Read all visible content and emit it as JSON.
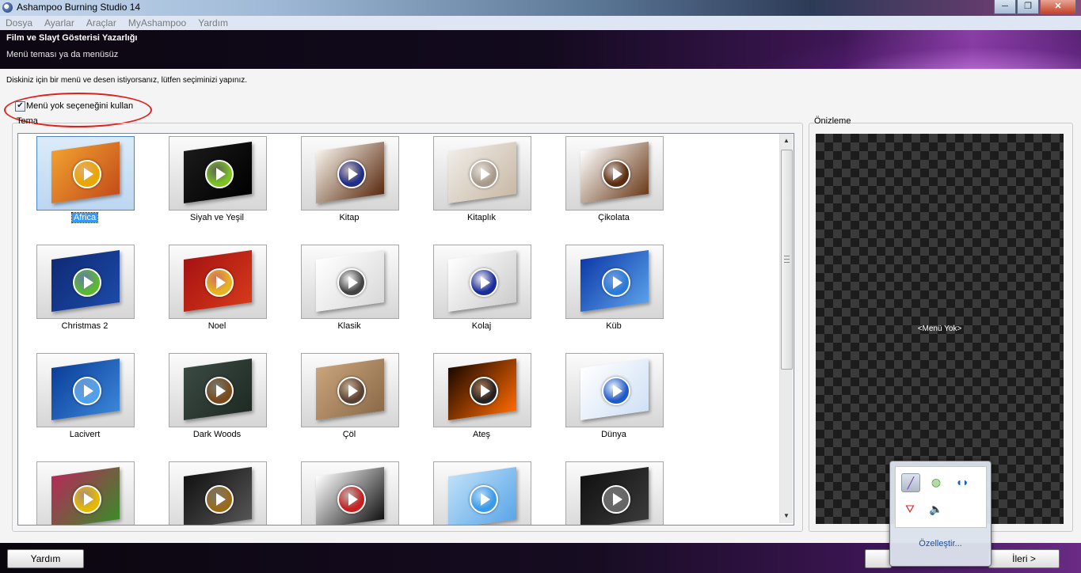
{
  "window": {
    "title": "Ashampoo Burning Studio 14",
    "buttons": [
      "─",
      "❐",
      "✕"
    ]
  },
  "menubar": [
    "Dosya",
    "Ayarlar",
    "Araçlar",
    "MyAshampoo",
    "Yardım"
  ],
  "header": {
    "title": "Film ve Slayt Gösterisi Yazarlığı",
    "subtitle": "Menü teması ya da menüsüz"
  },
  "instruction": "Diskiniz için bir menü ve desen istiyorsanız, lütfen seçiminizi yapınız.",
  "no_menu_option": {
    "label": "Menü yok seçeneğini kullan",
    "checked": true
  },
  "theme_group_label": "Tema",
  "preview_group_label": "Önizleme",
  "preview_text": "<Menü Yok>",
  "themes": [
    {
      "name": "Africa",
      "selected": true,
      "c1": "#f0a030",
      "c2": "#c44d1a",
      "btn": "#e8a800"
    },
    {
      "name": "Siyah ve Yeşil",
      "c1": "#1a1a1a",
      "c2": "#000000",
      "btn": "#7cc222"
    },
    {
      "name": "Kitap",
      "c1": "#f7f3ea",
      "c2": "#5a2a10",
      "btn": "#1f2e8a"
    },
    {
      "name": "Kitaplık",
      "c1": "#efece7",
      "c2": "#c9b9a5",
      "btn": "#a79a8c"
    },
    {
      "name": "Çikolata",
      "c1": "#ffffff",
      "c2": "#6b3b1a",
      "btn": "#5a2d12"
    },
    {
      "name": "Christmas 2",
      "c1": "#0f2a75",
      "c2": "#1c4aa8",
      "btn": "#5cb82e"
    },
    {
      "name": "Noel",
      "c1": "#a51212",
      "c2": "#d63a1a",
      "btn": "#e6b420"
    },
    {
      "name": "Klasik",
      "c1": "#ffffff",
      "c2": "#d9d9d9",
      "btn": "#444444"
    },
    {
      "name": "Kolaj",
      "c1": "#ffffff",
      "c2": "#cccccc",
      "btn": "#1a2a9a"
    },
    {
      "name": "Küb",
      "c1": "#0d3aa8",
      "c2": "#5aa0ea",
      "btn": "#2a7ad8"
    },
    {
      "name": "Lacivert",
      "c1": "#0a3e99",
      "c2": "#3b86d8",
      "btn": "#4fa0ec"
    },
    {
      "name": "Dark Woods",
      "c1": "#3a4a42",
      "c2": "#1e2a24",
      "btn": "#7a4a1a"
    },
    {
      "name": "Çöl",
      "c1": "#c9a47c",
      "c2": "#8b6a48",
      "btn": "#5a4030"
    },
    {
      "name": "Ateş",
      "c1": "#1a0800",
      "c2": "#ff6a00",
      "btn": "#222222"
    },
    {
      "name": "Dünya",
      "c1": "#ffffff",
      "c2": "#cfe0f5",
      "btn": "#1f5ac8"
    },
    {
      "name": "",
      "c1": "#b52a5a",
      "c2": "#3a8a2a",
      "btn": "#e8b800"
    },
    {
      "name": "",
      "c1": "#111111",
      "c2": "#555555",
      "btn": "#9a6a1a"
    },
    {
      "name": "",
      "c1": "#ffffff",
      "c2": "#111111",
      "btn": "#c82020"
    },
    {
      "name": "",
      "c1": "#bfe0f8",
      "c2": "#5aa6e8",
      "btn": "#3a9ae8"
    },
    {
      "name": "",
      "c1": "#111111",
      "c2": "#3a3a3a",
      "btn": "#666666"
    }
  ],
  "footer": {
    "help_button": "Yardım",
    "next_button": "İleri >"
  },
  "tray_popup": {
    "icons": [
      "pen-tool-icon",
      "utorrent-icon",
      "network-app-icon",
      "avira-antivirus-icon",
      "volume-icon"
    ],
    "customize_link": "Özelleştir..."
  }
}
